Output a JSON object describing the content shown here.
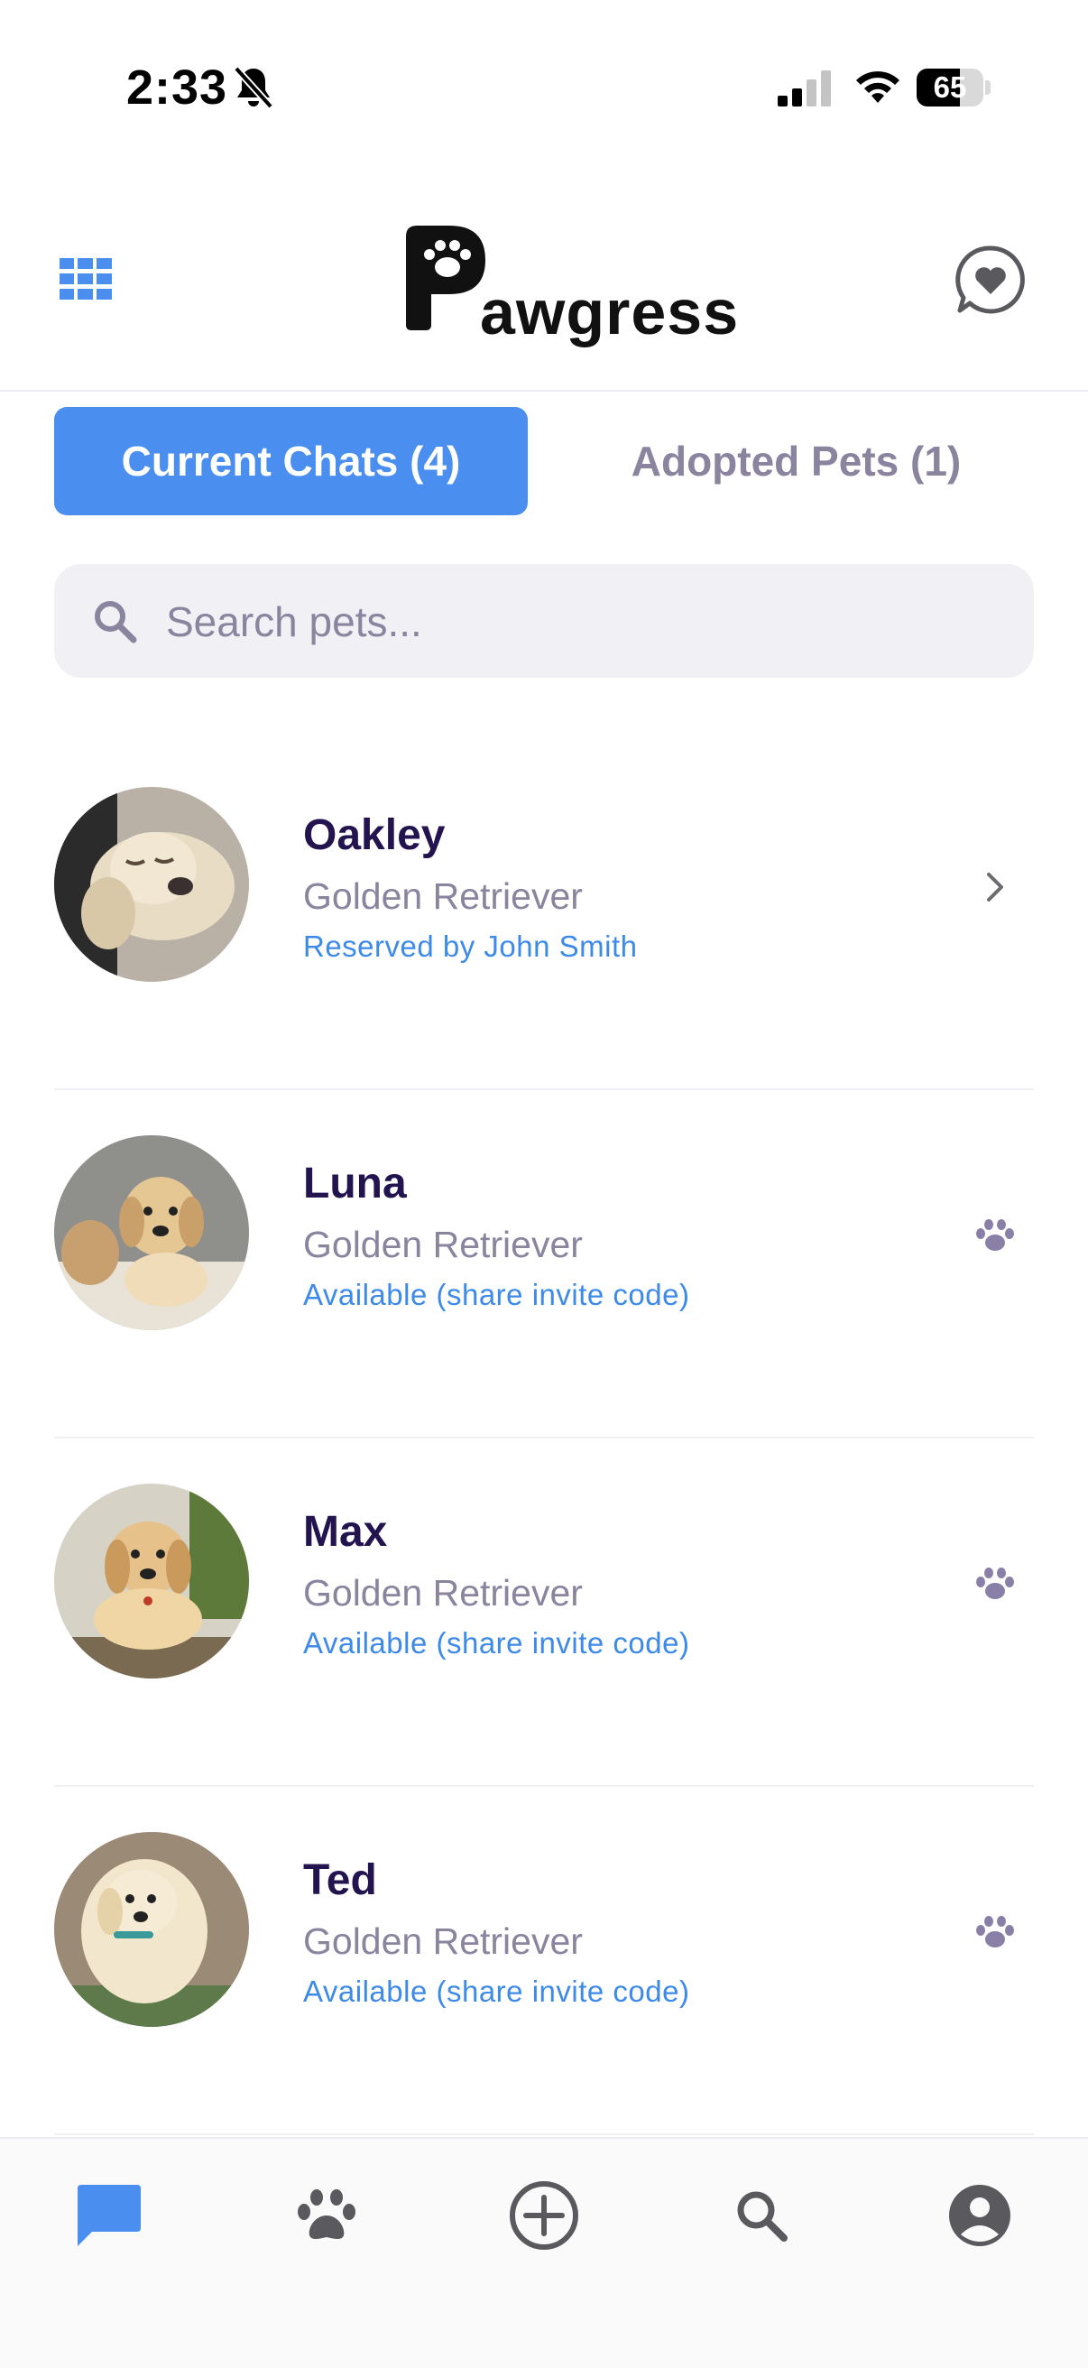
{
  "status_bar": {
    "time": "2:33",
    "battery": "65",
    "battery_level": 0.65
  },
  "header": {
    "logo_text": "awgress",
    "logo_initial": "P"
  },
  "tabs": [
    {
      "label": "Current Chats (4)",
      "active": true
    },
    {
      "label": "Adopted Pets (1)",
      "active": false
    }
  ],
  "search": {
    "placeholder": "Search pets..."
  },
  "pets": [
    {
      "name": "Oakley",
      "breed": "Golden Retriever",
      "status": "Reserved by John Smith",
      "action_icon": "chevron-right-icon"
    },
    {
      "name": "Luna",
      "breed": "Golden Retriever",
      "status": "Available (share invite code)",
      "action_icon": "paw-icon"
    },
    {
      "name": "Max",
      "breed": "Golden Retriever",
      "status": "Available (share invite code)",
      "action_icon": "paw-icon"
    },
    {
      "name": "Ted",
      "breed": "Golden Retriever",
      "status": "Available (share invite code)",
      "action_icon": "paw-icon"
    }
  ],
  "bottom_nav": [
    {
      "icon": "chat-icon",
      "active": true
    },
    {
      "icon": "paw-icon",
      "active": false
    },
    {
      "icon": "add-circle-icon",
      "active": false
    },
    {
      "icon": "search-icon",
      "active": false
    },
    {
      "icon": "profile-icon",
      "active": false
    }
  ],
  "colors": {
    "accent": "#4a8ff0",
    "name_text": "#23144f",
    "muted_text": "#8a849f",
    "status_link": "#3d8ae8",
    "nav_icon": "#5a5a5e"
  }
}
